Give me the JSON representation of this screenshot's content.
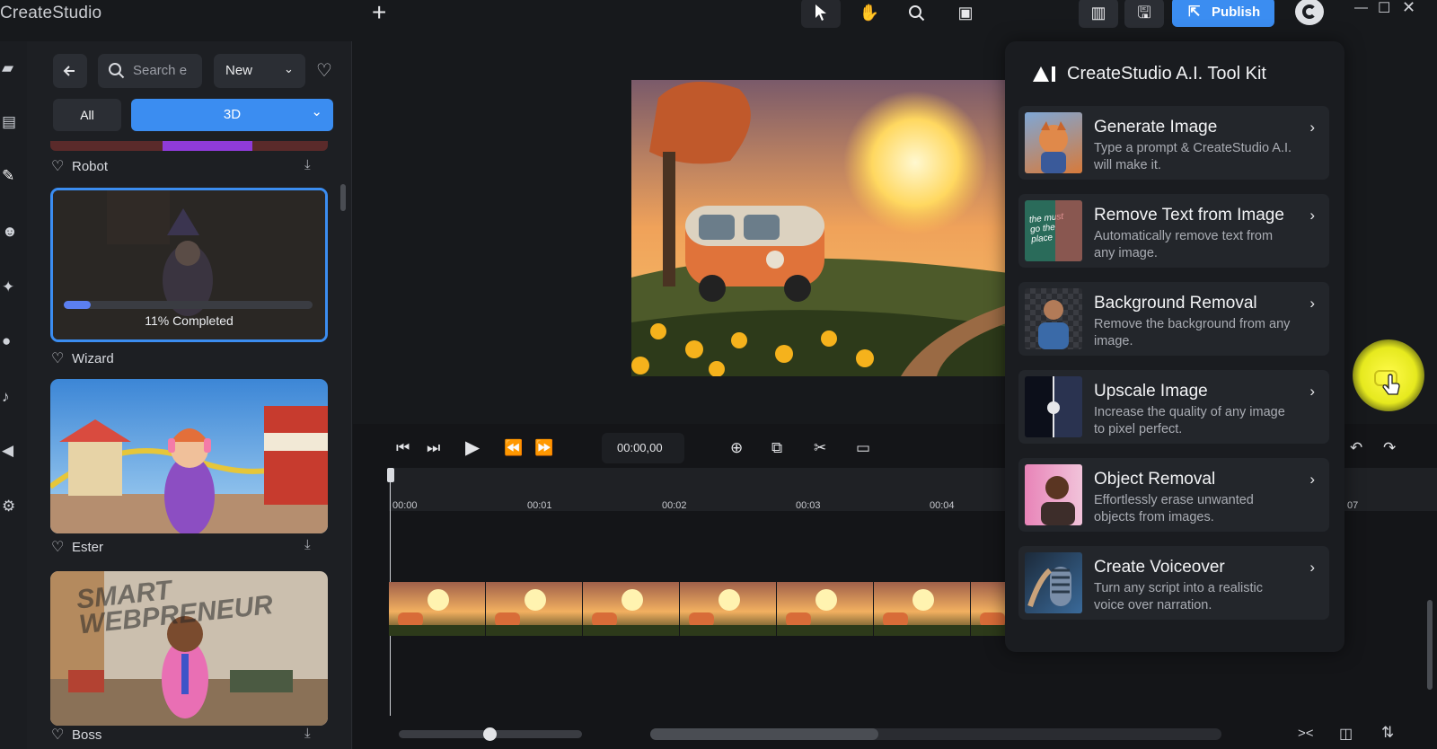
{
  "app": {
    "title": "CreateStudio"
  },
  "library": {
    "search_placeholder": "Search e",
    "sort_value": "New",
    "tabs": {
      "all": "All",
      "category": "3D"
    },
    "items": [
      {
        "label": "Robot"
      },
      {
        "label": "Wizard",
        "progress_text": "11% Completed",
        "progress": 0.11
      },
      {
        "label": "Ester"
      },
      {
        "label": "Boss"
      }
    ],
    "boss_sign_text": "SMART WEBPRENEUR"
  },
  "toolbar": {
    "publish_label": "Publish"
  },
  "timeline": {
    "timecode": "00:00,00",
    "ticks": [
      "00:00",
      "00:01",
      "00:02",
      "00:03",
      "00:04",
      "07"
    ]
  },
  "ai_panel": {
    "title": "CreateStudio A.I. Tool Kit",
    "tools": [
      {
        "name": "Generate Image",
        "desc": "Type a prompt & CreateStudio A.I. will make it."
      },
      {
        "name": "Remove Text from Image",
        "desc": "Automatically remove text from any image.",
        "thumb_text": "the must go the place"
      },
      {
        "name": "Background Removal",
        "desc": "Remove the background from any image."
      },
      {
        "name": "Upscale Image",
        "desc": "Increase the quality of any image to pixel perfect."
      },
      {
        "name": "Object Removal",
        "desc": "Effortlessly erase unwanted objects from images."
      },
      {
        "name": "Create Voiceover",
        "desc": "Turn any script into a realistic voice over narration."
      }
    ]
  },
  "colors": {
    "accent": "#3b8df1",
    "panel": "#1d1f23",
    "highlight": "#e6e91e"
  }
}
